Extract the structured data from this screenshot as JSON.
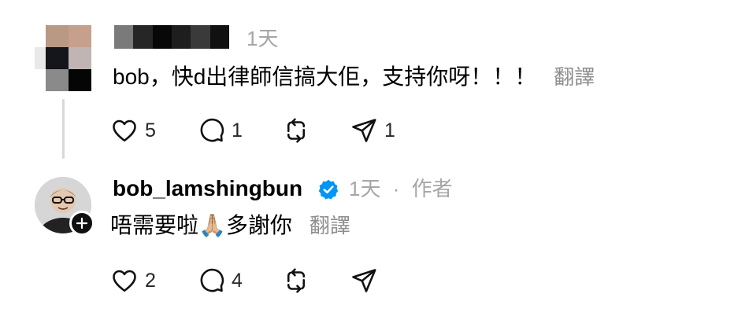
{
  "comment1": {
    "time": "1天",
    "text": "bob，快d出律師信搞大佢，支持你呀！！！",
    "translate_label": "翻譯",
    "likes": "5",
    "replies": "1",
    "shares": "1"
  },
  "comment2": {
    "username": "bob_lamshingbun",
    "time": "1天",
    "separator": "·",
    "role": "作者",
    "text": "唔需要啦🙏🏼多謝你",
    "translate_label": "翻譯",
    "likes": "2",
    "replies": "4"
  },
  "icons": {
    "like": "heart-icon",
    "reply": "comment-bubble-icon",
    "repost": "repost-icon",
    "share": "send-icon",
    "verified": "verified-badge-icon",
    "follow": "plus-icon"
  },
  "colors": {
    "text": "#000000",
    "muted": "#a6a6a6",
    "verified": "#0095f6",
    "thread_line": "#d8d8d8"
  }
}
